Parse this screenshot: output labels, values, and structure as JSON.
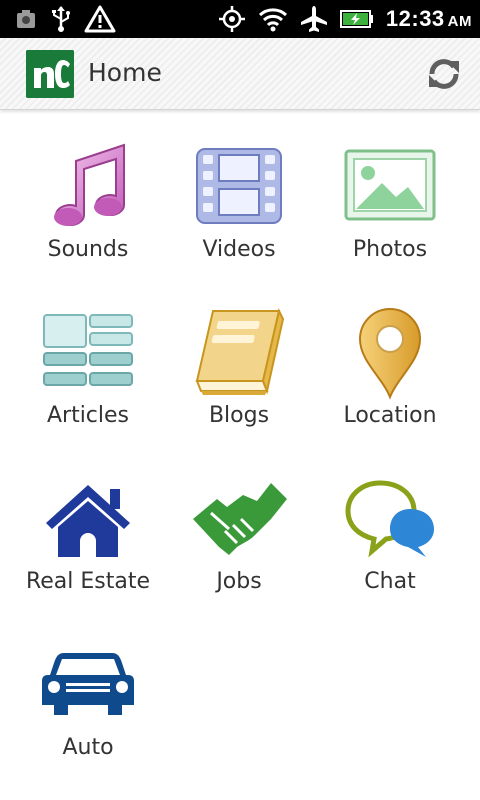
{
  "status_bar": {
    "icons": [
      "screenshot-icon",
      "usb-icon",
      "warning-icon",
      "gps-icon",
      "wifi-icon",
      "airplane-icon",
      "battery-charging-icon"
    ],
    "time": "12:33",
    "ampm": "AM"
  },
  "action_bar": {
    "logo_text": "nc",
    "title": "Home",
    "refresh_icon": "refresh-icon"
  },
  "colors": {
    "logo_green": "#1a7a3a",
    "house_blue": "#1f3a9a",
    "jobs_green": "#3a9a3a",
    "chat_blue": "#2e86d6",
    "chat_olive": "#8aa21a"
  },
  "grid": {
    "items": [
      {
        "label": "Sounds",
        "icon": "music-note-icon"
      },
      {
        "label": "Videos",
        "icon": "film-icon"
      },
      {
        "label": "Photos",
        "icon": "photo-icon"
      },
      {
        "label": "Articles",
        "icon": "articles-icon"
      },
      {
        "label": "Blogs",
        "icon": "notebook-icon"
      },
      {
        "label": "Location",
        "icon": "map-pin-icon"
      },
      {
        "label": "Real Estate",
        "icon": "house-icon"
      },
      {
        "label": "Jobs",
        "icon": "handshake-icon"
      },
      {
        "label": "Chat",
        "icon": "chat-bubbles-icon"
      },
      {
        "label": "Auto",
        "icon": "car-icon"
      }
    ]
  }
}
